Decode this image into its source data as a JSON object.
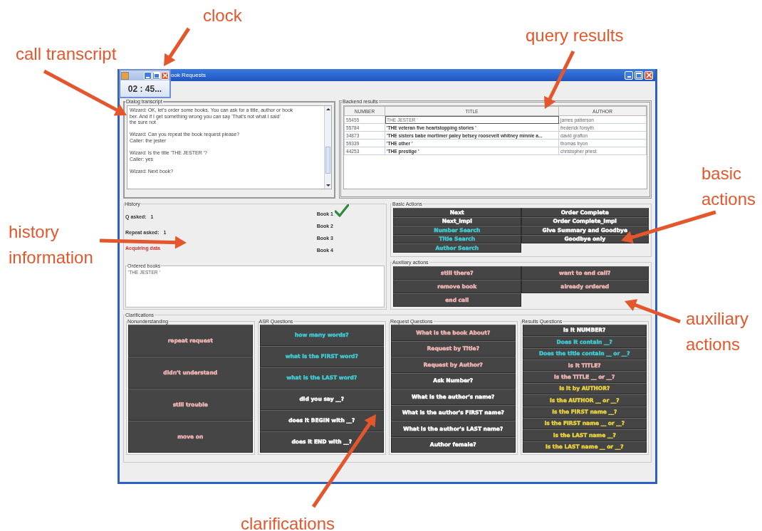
{
  "annotations": [
    {
      "lines": [
        "clock"
      ]
    },
    {
      "lines": [
        "call transcript"
      ]
    },
    {
      "lines": [
        "query results"
      ]
    },
    {
      "lines": [
        "basic",
        "actions"
      ]
    },
    {
      "lines": [
        "history",
        "information"
      ]
    },
    {
      "lines": [
        "auxiliary",
        "actions"
      ]
    },
    {
      "lines": [
        "clarifications"
      ]
    }
  ],
  "clock_dialog": {
    "time": "02 : 45..."
  },
  "window": {
    "title": "ook Requests"
  },
  "transcript": {
    "title": "Dialog transcript",
    "turns": [
      [
        "Wizard: OK, let's order some books. You can ask for a title, author or book",
        "ber. And if I get something wrong you can say 'That's not what I said'",
        "the sure not"
      ],
      [
        "Wizard: Can you repeat the book request please?",
        "Caller: the jester"
      ],
      [
        "Wizard: Is the title 'THE JESTER '?",
        "Caller: yes"
      ],
      [
        "Wizard: Next book?"
      ]
    ]
  },
  "backend_results": {
    "title": "Backend results",
    "columns": [
      "NUMBER",
      "TITLE",
      "AUTHOR"
    ],
    "rows": [
      {
        "cells": [
          "55455",
          "THE JESTER '",
          "james patterson"
        ],
        "selected": true
      },
      {
        "cells": [
          "55784",
          "'THE veteran five heartstopping stories '",
          "frederick forsyth"
        ],
        "selected": false
      },
      {
        "cells": [
          "34873",
          "'THE sisters babe mortimer paley betsey roosevelt whitney minnie a...",
          "david grafton"
        ],
        "selected": false
      },
      {
        "cells": [
          "59339",
          "'THE other '",
          "thomas tryon"
        ],
        "selected": false
      },
      {
        "cells": [
          "44253",
          "'THE prestige '",
          "christopher priest"
        ],
        "selected": false
      }
    ]
  },
  "history": {
    "title": "History",
    "stats": [
      {
        "label": "Q asked:",
        "value": "1"
      },
      {
        "label": "Repeat asked:",
        "value": "1"
      }
    ],
    "status": "Acquiring data",
    "books": [
      {
        "label": "Book 1",
        "done": true
      },
      {
        "label": "Book 2",
        "done": false
      },
      {
        "label": "Book 3",
        "done": false
      },
      {
        "label": "Book 4",
        "done": false
      }
    ],
    "ordered": {
      "title": "Ordered books",
      "items": [
        "'THE JESTER '"
      ]
    }
  },
  "basic_actions": {
    "title": "Basic Actions",
    "buttons": [
      {
        "label": "Next",
        "color": "#ffffff"
      },
      {
        "label": "Next_Impl",
        "color": "#ffffff"
      },
      {
        "label": "Number Search",
        "color": "#40c8d0"
      },
      {
        "label": "Title Search",
        "color": "#40c8d0"
      },
      {
        "label": "Author Search",
        "color": "#40c8d0"
      },
      {
        "label": "Order Complete",
        "color": "#ffffff"
      },
      {
        "label": "Order Complete_Impl",
        "color": "#ffffff"
      },
      {
        "label": "Give Summary and Goodbye",
        "color": "#ffffff"
      },
      {
        "label": "Goodbye only",
        "color": "#ffffff"
      }
    ]
  },
  "auxiliary_actions": {
    "title": "Auxiliary actions",
    "buttons": [
      {
        "label": "still there?",
        "color": "#f0b4b4"
      },
      {
        "label": "want to end call?",
        "color": "#f0b4b4"
      },
      {
        "label": "remove book",
        "color": "#f0b4b4"
      },
      {
        "label": "already ordered",
        "color": "#f0b4b4"
      },
      {
        "label": "end call",
        "color": "#f0b4b4"
      }
    ]
  },
  "clarifications": {
    "title": "Clarifications",
    "groups": [
      {
        "title": "Nonunderstanding",
        "buttons": [
          {
            "label": "repeat request",
            "color": "#f0b4b4"
          },
          {
            "label": "didn't understand",
            "color": "#f0b4b4"
          },
          {
            "label": "still trouble",
            "color": "#f0b4b4"
          },
          {
            "label": "move on",
            "color": "#f0b4b4"
          }
        ]
      },
      {
        "title": "ASR Questions",
        "buttons": [
          {
            "label": "how many words?",
            "color": "#40c8d0"
          },
          {
            "label": "what is the FIRST word?",
            "color": "#40c8d0"
          },
          {
            "label": "what is the LAST word?",
            "color": "#40c8d0"
          },
          {
            "label": "did you say __?",
            "color": "#ffffff"
          },
          {
            "label": "does it BEGIN with __?",
            "color": "#ffffff"
          },
          {
            "label": "does it END with __?",
            "color": "#ffffff"
          }
        ]
      },
      {
        "title": "Request Questions",
        "buttons": [
          {
            "label": "What is the book About?",
            "color": "#f0b4b4"
          },
          {
            "label": "Request by Title?",
            "color": "#f0b4b4"
          },
          {
            "label": "Request by Author?",
            "color": "#f0b4b4"
          },
          {
            "label": "Ask Number?",
            "color": "#ffffff"
          },
          {
            "label": "What is the author's name?",
            "color": "#ffffff"
          },
          {
            "label": "What is the author's FIRST name?",
            "color": "#ffffff"
          },
          {
            "label": "What is the author's LAST name?",
            "color": "#ffffff"
          },
          {
            "label": "Author female?",
            "color": "#ffffff"
          }
        ]
      },
      {
        "title": "Results Questions",
        "buttons": [
          {
            "label": "Is it NUMBER?",
            "color": "#ffffff"
          },
          {
            "label": "Does it contain __?",
            "color": "#40c8d0"
          },
          {
            "label": "Does the title contain __ or __?",
            "color": "#40c8d0"
          },
          {
            "label": "Is it TITLE?",
            "color": "#f0b4b4"
          },
          {
            "label": "Is the TITLE __ or __?",
            "color": "#f0b4b4"
          },
          {
            "label": "Is it by AUTHOR?",
            "color": "#e8d040"
          },
          {
            "label": "Is the AUTHOR __ or __?",
            "color": "#e8d040"
          },
          {
            "label": "Is the FIRST name __?",
            "color": "#e8d040"
          },
          {
            "label": "Is the FIRST name __ or __?",
            "color": "#e8d040"
          },
          {
            "label": "Is the LAST name __?",
            "color": "#e8d040"
          },
          {
            "label": "Is the LAST name __ or __?",
            "color": "#e8d040"
          }
        ]
      }
    ]
  }
}
